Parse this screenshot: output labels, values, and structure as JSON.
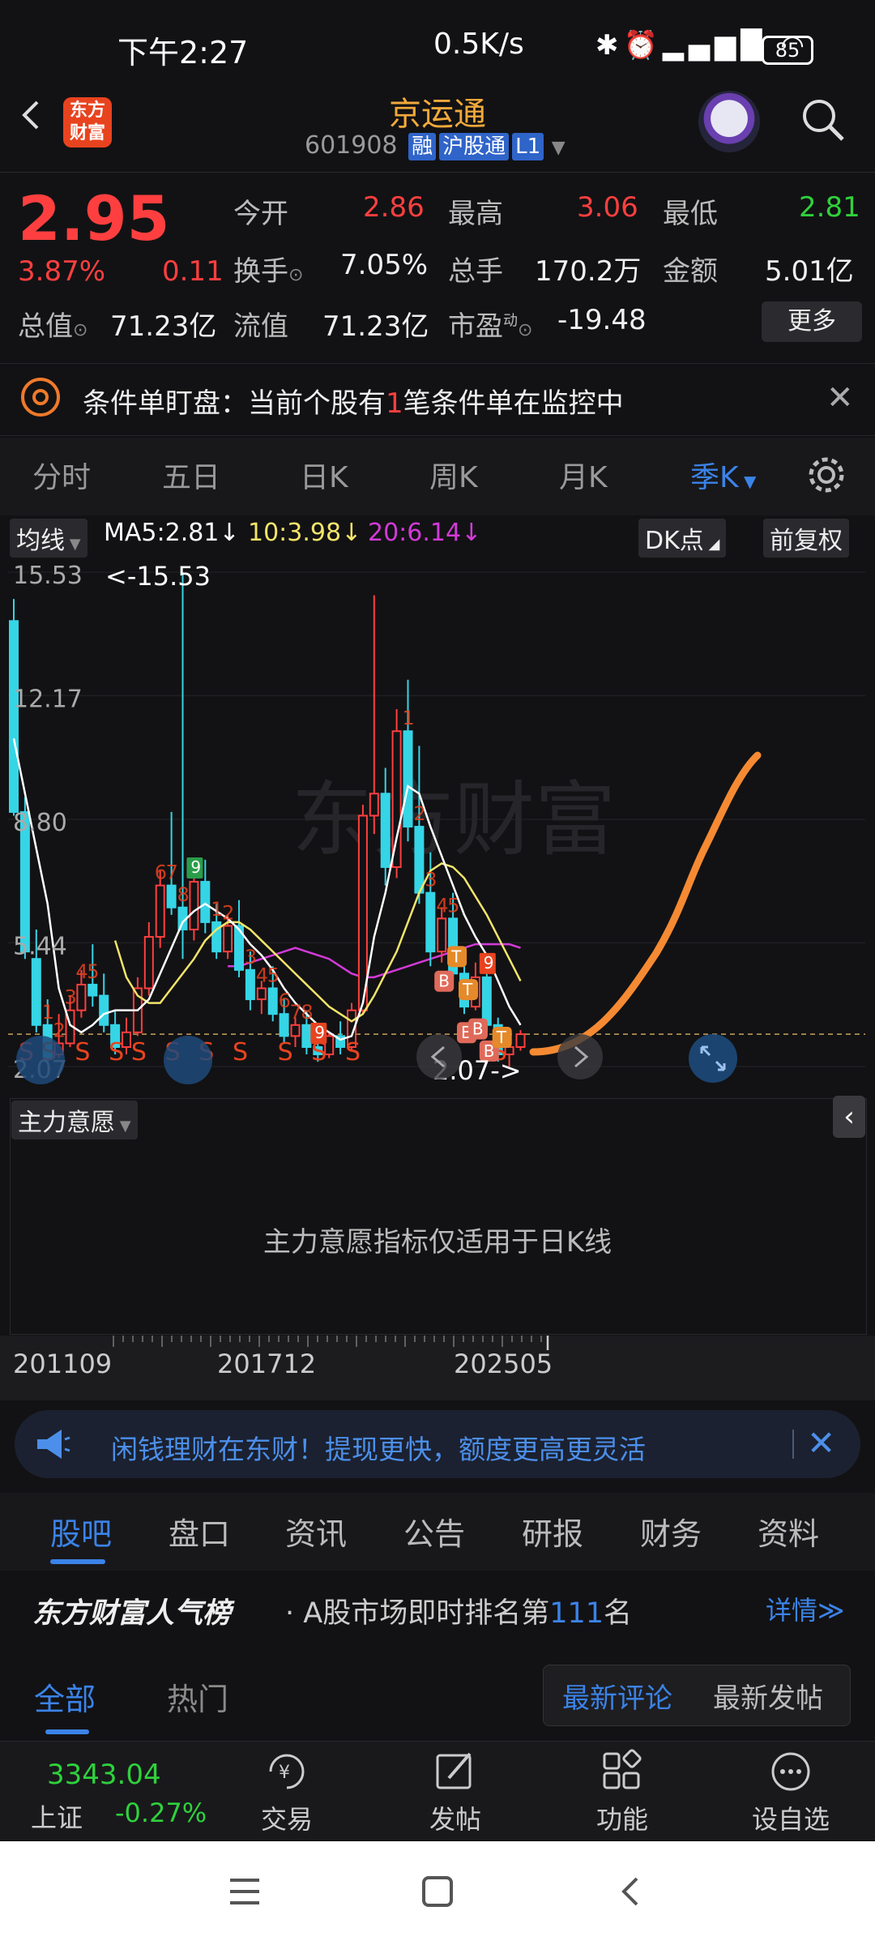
{
  "status": {
    "time": "下午2:27",
    "net": "0.5K/s",
    "battery": "85"
  },
  "header": {
    "logo": "东方\n财富",
    "name": "京运通",
    "code": "601908",
    "tags": [
      "融",
      "沪股通",
      "L1"
    ]
  },
  "quote": {
    "price": "2.95",
    "pct": "3.87%",
    "chg": "0.11",
    "fields": {
      "open_label": "今开",
      "open": "2.86",
      "high_label": "最高",
      "high": "3.06",
      "low_label": "最低",
      "low": "2.81",
      "turnover_label": "换手",
      "turnover": "7.05%",
      "vol_label": "总手",
      "vol": "170.2万",
      "amount_label": "金额",
      "amount": "5.01亿",
      "mktcap_label": "总值",
      "mktcap": "71.23亿",
      "float_label": "流值",
      "float": "71.23亿",
      "pe_label": "市盈",
      "pe_sup": "动",
      "pe": "-19.48"
    },
    "more": "更多"
  },
  "notice": {
    "prefix": "条件单盯盘：当前个股有",
    "count": "1",
    "suffix": "笔条件单在监控中"
  },
  "period_tabs": [
    "分时",
    "五日",
    "日K",
    "周K",
    "月K",
    "季K"
  ],
  "period_active": "季K",
  "chart_header": {
    "ma_btn": "均线",
    "ma5": "MA5:2.81↓",
    "ma10": "10:3.98↓",
    "ma20": "20:6.14↓",
    "dk": "DK点",
    "adj": "前复权"
  },
  "chart_data": {
    "type": "candlestick",
    "y_ticks": [
      "15.53",
      "12.17",
      "8.80",
      "5.44",
      "2.07"
    ],
    "max_label": "<-15.53",
    "min_label": "2.07->",
    "x_ticks": [
      "201109",
      "201712",
      "202505"
    ],
    "colors": {
      "up": "#ff3f3f",
      "down": "#35d5e6",
      "ma5": "#ffffff",
      "ma10": "#f3e46a",
      "ma20": "#d33ad8",
      "forecast": "#f58a33"
    },
    "candles": [
      [
        14.2,
        14.8,
        9.0,
        8.9
      ],
      [
        9.0,
        9.4,
        5.2,
        5.0
      ],
      [
        5.0,
        5.8,
        3.2,
        3.0
      ],
      [
        3.2,
        3.9,
        2.3,
        2.2
      ],
      [
        2.4,
        3.5,
        2.7,
        2.3
      ],
      [
        2.7,
        4.0,
        3.6,
        2.6
      ],
      [
        3.6,
        4.7,
        4.3,
        3.4
      ],
      [
        4.3,
        5.4,
        4.0,
        3.7
      ],
      [
        4.0,
        4.6,
        3.2,
        3.0
      ],
      [
        3.2,
        3.6,
        2.6,
        2.4
      ],
      [
        2.6,
        3.4,
        3.0,
        2.4
      ],
      [
        3.0,
        4.5,
        4.2,
        2.9
      ],
      [
        4.2,
        6.0,
        5.6,
        4.0
      ],
      [
        5.6,
        7.4,
        7.0,
        5.3
      ],
      [
        7.0,
        9.0,
        6.4,
        6.2
      ],
      [
        6.4,
        15.53,
        5.8,
        5.0
      ],
      [
        5.8,
        7.5,
        7.1,
        5.5
      ],
      [
        7.1,
        7.7,
        6.0,
        5.7
      ],
      [
        6.0,
        6.5,
        5.2,
        5.0
      ],
      [
        5.2,
        6.2,
        5.9,
        5.0
      ],
      [
        5.9,
        6.6,
        4.7,
        4.5
      ],
      [
        4.7,
        5.2,
        3.9,
        3.6
      ],
      [
        3.9,
        4.4,
        4.2,
        3.5
      ],
      [
        4.2,
        4.8,
        3.5,
        3.3
      ],
      [
        3.5,
        3.9,
        2.9,
        2.7
      ],
      [
        2.9,
        3.4,
        3.2,
        2.6
      ],
      [
        3.2,
        3.6,
        2.6,
        2.4
      ],
      [
        2.6,
        3.0,
        2.4,
        2.2
      ],
      [
        2.4,
        3.0,
        2.9,
        2.3
      ],
      [
        2.9,
        3.3,
        2.6,
        2.4
      ],
      [
        2.6,
        3.8,
        3.6,
        2.5
      ],
      [
        3.6,
        9.2,
        8.9,
        3.5
      ],
      [
        8.9,
        14.9,
        9.5,
        8.4
      ],
      [
        9.5,
        10.2,
        7.5,
        7.0
      ],
      [
        7.5,
        11.8,
        11.2,
        7.2
      ],
      [
        11.2,
        12.6,
        8.6,
        8.2
      ],
      [
        8.6,
        10.8,
        6.8,
        6.5
      ],
      [
        6.8,
        7.9,
        5.2,
        4.8
      ],
      [
        5.2,
        6.4,
        6.1,
        4.9
      ],
      [
        6.1,
        6.8,
        4.6,
        4.4
      ],
      [
        4.6,
        5.0,
        3.7,
        3.5
      ],
      [
        3.7,
        4.9,
        4.5,
        3.6
      ],
      [
        4.5,
        5.1,
        3.2,
        3.0
      ],
      [
        3.2,
        3.4,
        2.4,
        2.2
      ],
      [
        2.4,
        2.9,
        2.6,
        2.07
      ],
      [
        2.6,
        3.06,
        2.95,
        2.5
      ]
    ],
    "ma5": [
      11.0,
      9.5,
      8.0,
      6.5,
      4.2,
      3.2,
      3.0,
      3.2,
      3.5,
      3.6,
      3.6,
      3.6,
      3.9,
      4.6,
      5.3,
      6.0,
      6.3,
      6.5,
      6.3,
      6.1,
      5.8,
      5.4,
      5.1,
      4.7,
      4.2,
      3.8,
      3.5,
      3.2,
      3.0,
      2.8,
      2.9,
      3.8,
      5.6,
      6.8,
      8.3,
      9.7,
      9.5,
      8.6,
      7.8,
      7.0,
      6.2,
      5.6,
      5.1,
      4.4,
      3.7,
      3.2
    ],
    "ma10": [
      null,
      null,
      null,
      null,
      null,
      null,
      null,
      null,
      null,
      5.5,
      4.5,
      4.0,
      3.8,
      3.8,
      4.2,
      4.6,
      5.0,
      5.5,
      5.8,
      6.0,
      6.0,
      5.8,
      5.5,
      5.2,
      4.9,
      4.6,
      4.3,
      4.0,
      3.7,
      3.5,
      3.3,
      3.5,
      4.0,
      4.6,
      5.2,
      6.0,
      6.8,
      7.4,
      7.6,
      7.5,
      7.2,
      6.7,
      6.2,
      5.6,
      5.0,
      4.4
    ],
    "ma20": [
      null,
      null,
      null,
      null,
      null,
      null,
      null,
      null,
      null,
      null,
      null,
      null,
      null,
      null,
      null,
      null,
      null,
      null,
      null,
      4.8,
      4.8,
      4.9,
      5.0,
      5.1,
      5.2,
      5.3,
      5.2,
      5.1,
      5.0,
      4.8,
      4.6,
      4.5,
      4.5,
      4.6,
      4.7,
      4.8,
      4.9,
      5.0,
      5.1,
      5.2,
      5.3,
      5.4,
      5.4,
      5.4,
      5.4,
      5.3
    ],
    "markers": {
      "numbers": [
        [
          3,
          "1"
        ],
        [
          4,
          "2"
        ],
        [
          5,
          "3"
        ],
        [
          6,
          "4"
        ],
        [
          7,
          "5"
        ],
        [
          13,
          "6"
        ],
        [
          14,
          "7"
        ],
        [
          15,
          "8"
        ],
        [
          16,
          "9"
        ],
        [
          18,
          "1"
        ],
        [
          19,
          "2"
        ],
        [
          21,
          "3"
        ],
        [
          22,
          "4"
        ],
        [
          23,
          "5"
        ],
        [
          24,
          "6"
        ],
        [
          25,
          "7"
        ],
        [
          26,
          "8"
        ],
        [
          27,
          "9"
        ],
        [
          35,
          "1"
        ],
        [
          36,
          "2"
        ],
        [
          37,
          "3"
        ],
        [
          38,
          "4"
        ],
        [
          39,
          "5"
        ],
        [
          42,
          "9"
        ]
      ],
      "sells": [
        1,
        3,
        6,
        9,
        11,
        14,
        17,
        20,
        24,
        27,
        30,
        43
      ],
      "buys": [
        38,
        40,
        41,
        42
      ],
      "ts": [
        39,
        40,
        43
      ]
    }
  },
  "indicator": {
    "label": "主力意愿",
    "message": "主力意愿指标仅适用于日K线"
  },
  "date_axis": [
    "201109",
    "201712",
    "202505"
  ],
  "ad": {
    "text": "闲钱理财在东财！提现更快，额度更高更灵活"
  },
  "section_tabs": [
    "股吧",
    "盘口",
    "资讯",
    "公告",
    "研报",
    "财务",
    "资料"
  ],
  "section_active": "股吧",
  "rank": {
    "brand": "东方财富人气榜",
    "prefix": "· A股市场即时排名第",
    "num": "111",
    "suffix": "名",
    "detail": "详情≫"
  },
  "feed_tabs": [
    "全部",
    "热门"
  ],
  "sort": {
    "latest_comment": "最新评论",
    "latest_post": "最新发帖"
  },
  "toolbar": {
    "index_value": "3343.04",
    "index_name": "上证",
    "index_pct": "-0.27%",
    "items": [
      "交易",
      "发帖",
      "功能",
      "设自选"
    ]
  }
}
